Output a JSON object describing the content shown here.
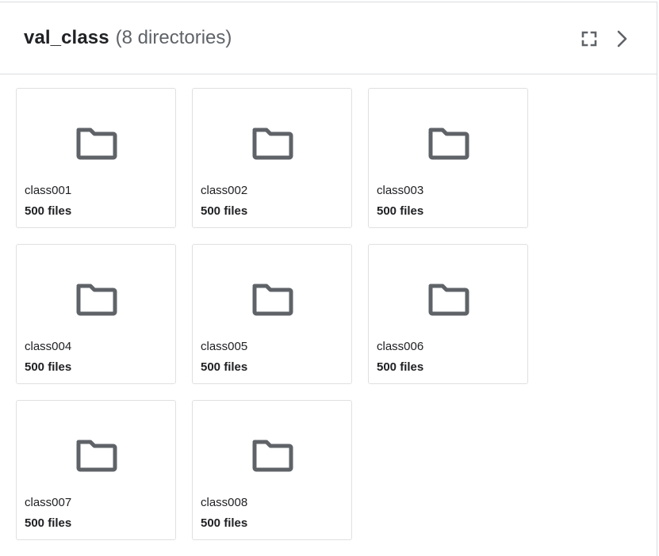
{
  "header": {
    "title": "val_class",
    "subtitle": "(8 directories)",
    "fullscreen_icon": "fullscreen-icon",
    "next_icon": "chevron-right-icon"
  },
  "folder_icon": "folder-icon",
  "directories": [
    {
      "name": "class001",
      "count": "500 files"
    },
    {
      "name": "class002",
      "count": "500 files"
    },
    {
      "name": "class003",
      "count": "500 files"
    },
    {
      "name": "class004",
      "count": "500 files"
    },
    {
      "name": "class005",
      "count": "500 files"
    },
    {
      "name": "class006",
      "count": "500 files"
    },
    {
      "name": "class007",
      "count": "500 files"
    },
    {
      "name": "class008",
      "count": "500 files"
    }
  ],
  "colors": {
    "icon": "#5f6368",
    "border": "#e0e0e0",
    "text": "#202124"
  }
}
